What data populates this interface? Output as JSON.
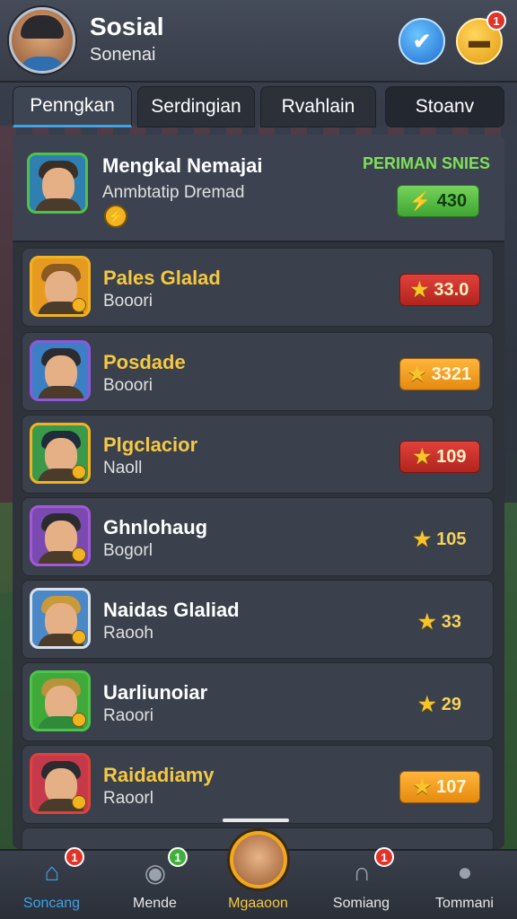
{
  "header": {
    "title": "Sosial",
    "subtitle": "Sonenai",
    "notif_badge": "1"
  },
  "tabs": [
    {
      "label": "Penngkan",
      "active": true
    },
    {
      "label": "Serdingian",
      "active": false
    },
    {
      "label": "Rvahlain",
      "active": false
    },
    {
      "label": "Stoanv",
      "active": false
    }
  ],
  "featured": {
    "name": "Mengkal Nemajai",
    "sub": "Anmbtatip Dremad",
    "tag": "PERIMAN SNIES",
    "score": "430"
  },
  "rows": [
    {
      "name": "Pales Glalad",
      "sub": "Booori",
      "score": "33.0",
      "style": "red",
      "name_color": "gold"
    },
    {
      "name": "Posdade",
      "sub": "Booori",
      "score": "3321",
      "style": "orange",
      "name_color": "gold"
    },
    {
      "name": "Plgclacior",
      "sub": "Naoll",
      "score": "109",
      "style": "red",
      "name_color": "gold"
    },
    {
      "name": "Ghnlohaug",
      "sub": "Bogorl",
      "score": "105",
      "style": "plain",
      "name_color": "white"
    },
    {
      "name": "Naidas Glaliad",
      "sub": "Raooh",
      "score": "33",
      "style": "plain",
      "name_color": "white"
    },
    {
      "name": "Uarliunoiar",
      "sub": "Raoori",
      "score": "29",
      "style": "plain",
      "name_color": "white"
    },
    {
      "name": "Raidadiamy",
      "sub": "Raoorl",
      "score": "107",
      "style": "orange",
      "name_color": "gold"
    }
  ],
  "nav": [
    {
      "label": "Soncang",
      "icon": "home-icon",
      "badge": "1",
      "active": true
    },
    {
      "label": "Mende",
      "icon": "camera-icon",
      "badge": "1",
      "active": false
    },
    {
      "label": "Mgaaoon",
      "icon": "player-avatar",
      "badge": "",
      "active": false
    },
    {
      "label": "Somiang",
      "icon": "horseshoe-icon",
      "badge": "1",
      "active": false
    },
    {
      "label": "Tommani",
      "icon": "profile-icon",
      "badge": "",
      "active": false
    }
  ]
}
